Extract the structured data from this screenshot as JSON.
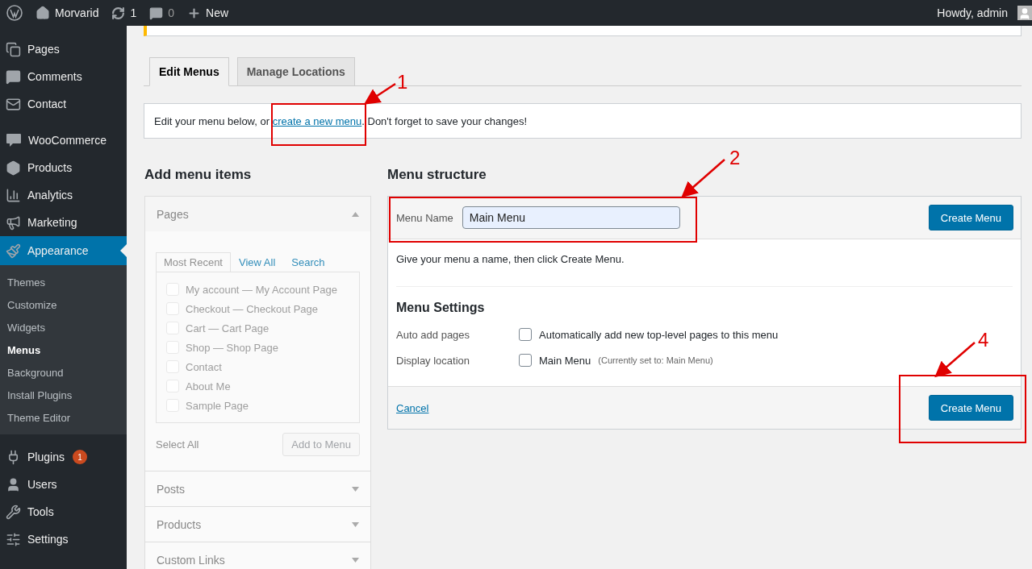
{
  "admin_bar": {
    "site": "Morvarid",
    "updates": "1",
    "comments": "0",
    "new": "New",
    "greeting": "Howdy, admin"
  },
  "sidebar": {
    "sections": [
      {
        "items": [
          {
            "label": "Pages",
            "selected": false
          },
          {
            "label": "Comments",
            "selected": false
          },
          {
            "label": "Contact",
            "selected": false
          }
        ]
      },
      {
        "items": [
          {
            "label": "WooCommerce",
            "selected": false
          },
          {
            "label": "Products",
            "selected": false
          },
          {
            "label": "Analytics",
            "selected": false
          },
          {
            "label": "Marketing",
            "selected": false
          },
          {
            "label": "Appearance",
            "selected": true,
            "children": [
              {
                "label": "Themes",
                "selected": false
              },
              {
                "label": "Customize",
                "selected": false
              },
              {
                "label": "Widgets",
                "selected": false
              },
              {
                "label": "Menus",
                "selected": true
              },
              {
                "label": "Background",
                "selected": false
              },
              {
                "label": "Install Plugins",
                "selected": false
              },
              {
                "label": "Theme Editor",
                "selected": false
              }
            ]
          }
        ]
      },
      {
        "items": [
          {
            "label": "Plugins",
            "selected": false,
            "badge": "1"
          },
          {
            "label": "Users",
            "selected": false
          },
          {
            "label": "Tools",
            "selected": false
          },
          {
            "label": "Settings",
            "selected": false
          }
        ]
      }
    ]
  },
  "tabs": [
    {
      "label": "Edit Menus",
      "selected": true
    },
    {
      "label": "Manage Locations",
      "selected": false
    }
  ],
  "intro": {
    "before": "Edit your menu below, or ",
    "link": "create a new menu",
    "after": ". Don't forget to save your changes!"
  },
  "add_menu_items": {
    "heading": "Add menu items",
    "disabled": true,
    "panels": [
      {
        "title": "Pages",
        "expanded": true,
        "tabs": [
          {
            "label": "Most Recent",
            "selected": true
          },
          {
            "label": "View All",
            "selected": false
          },
          {
            "label": "Search",
            "selected": false
          }
        ],
        "items": [
          {
            "label": "My account — My Account Page",
            "checked": false
          },
          {
            "label": "Checkout — Checkout Page",
            "checked": false
          },
          {
            "label": "Cart — Cart Page",
            "checked": false
          },
          {
            "label": "Shop — Shop Page",
            "checked": false
          },
          {
            "label": "Contact",
            "checked": false
          },
          {
            "label": "About Me",
            "checked": false
          },
          {
            "label": "Sample Page",
            "checked": false
          }
        ],
        "select_all": "Select All",
        "add_button": "Add to Menu"
      },
      {
        "title": "Posts",
        "expanded": false
      },
      {
        "title": "Products",
        "expanded": false
      },
      {
        "title": "Custom Links",
        "expanded": false
      }
    ]
  },
  "menu_structure": {
    "heading": "Menu structure",
    "name_label": "Menu Name",
    "name_value": "Main Menu",
    "create_button": "Create Menu",
    "hint": "Give your menu a name, then click Create Menu.",
    "settings_heading": "Menu Settings",
    "settings": [
      {
        "label": "Auto add pages",
        "option": "Automatically add new top-level pages to this menu",
        "checked": false
      },
      {
        "label": "Display location",
        "option": "Main Menu",
        "note": "(Currently set to: Main Menu)",
        "checked": false
      }
    ],
    "cancel": "Cancel",
    "footer_button": "Create Menu"
  },
  "annotations": [
    {
      "label": "1"
    },
    {
      "label": "2"
    },
    {
      "label": "4"
    }
  ]
}
